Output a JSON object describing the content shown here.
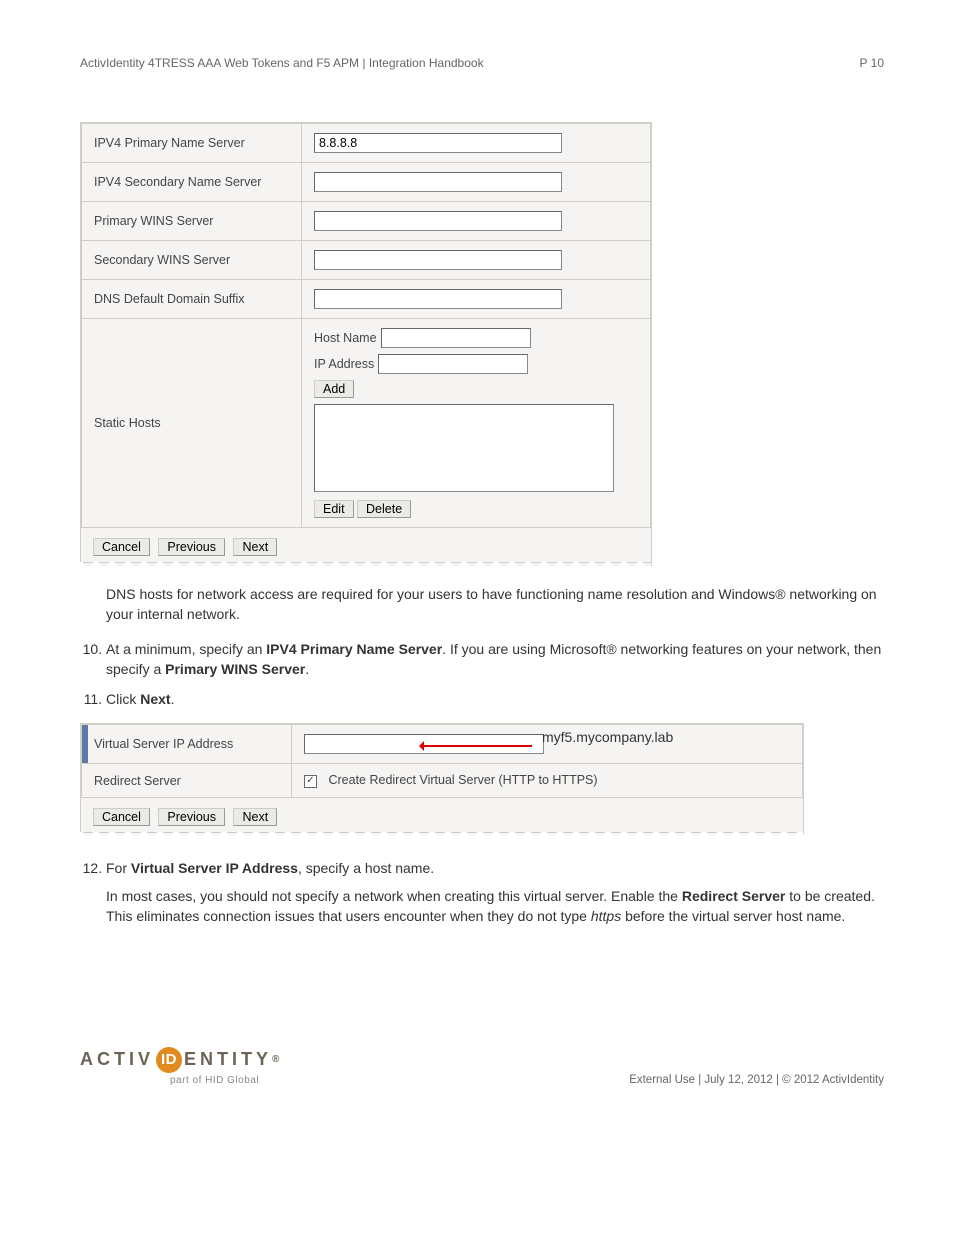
{
  "header": {
    "title": "ActivIdentity 4TRESS AAA Web Tokens and F5 APM | Integration Handbook",
    "page": "P 10"
  },
  "shot1": {
    "rows": {
      "ipv4pri": {
        "label": "IPV4 Primary Name Server",
        "value": "8.8.8.8"
      },
      "ipv4sec": {
        "label": "IPV4 Secondary Name Server",
        "value": ""
      },
      "winspri": {
        "label": "Primary WINS Server",
        "value": ""
      },
      "winssec": {
        "label": "Secondary WINS Server",
        "value": ""
      },
      "dnssuf": {
        "label": "DNS Default Domain Suffix",
        "value": ""
      },
      "static": {
        "label": "Static Hosts"
      }
    },
    "static": {
      "hostname_label": "Host Name",
      "hostname_value": "",
      "ip_label": "IP Address",
      "ip_value": "",
      "add": "Add",
      "edit": "Edit",
      "delete": "Delete"
    },
    "nav": {
      "cancel": "Cancel",
      "previous": "Previous",
      "next": "Next"
    }
  },
  "para_dns": "DNS hosts for network access are required for your users to have functioning name resolution and Windows® networking on your internal network.",
  "steps": {
    "s10a": "At a minimum, specify an ",
    "s10b": "IPV4 Primary Name Server",
    "s10c": ". If you are using Microsoft® networking features on your network, then specify a ",
    "s10d": "Primary WINS Server",
    "s10e": ".",
    "s11a": "Click ",
    "s11b": "Next",
    "s11c": ".",
    "s12a": "For ",
    "s12b": "Virtual Server IP Address",
    "s12c": ", specify a host name.",
    "s12p1a": "In most cases, you should not specify a network when creating this virtual server. Enable the ",
    "s12p1b": "Redirect Server",
    "s12p1c": " to be created. This eliminates connection issues that users encounter when they do not type ",
    "s12p1d": "https",
    "s12p1e": " before the virtual server host name."
  },
  "shot2": {
    "vs_label": "Virtual Server IP Address",
    "vs_value": "",
    "vs_anno": "myf5.mycompany.lab",
    "rs_label": "Redirect Server",
    "rs_chk_label": "Create Redirect Virtual Server (HTTP to HTTPS)",
    "rs_checked": true,
    "nav": {
      "cancel": "Cancel",
      "previous": "Previous",
      "next": "Next"
    }
  },
  "footer": {
    "right": "External Use | July 12, 2012 | © 2012 ActivIdentity",
    "brand_left": "ACTIV",
    "brand_mark": "ID",
    "brand_right": "ENTITY",
    "brand_sub": "part of HID Global"
  }
}
